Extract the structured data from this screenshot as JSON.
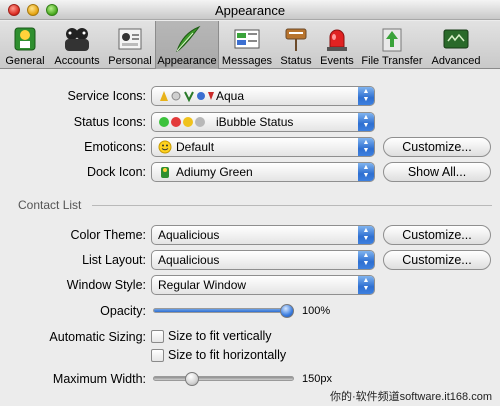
{
  "window": {
    "title": "Appearance"
  },
  "toolbar": {
    "items": [
      {
        "label": "General"
      },
      {
        "label": "Accounts"
      },
      {
        "label": "Personal"
      },
      {
        "label": "Appearance"
      },
      {
        "label": "Messages"
      },
      {
        "label": "Status"
      },
      {
        "label": "Events"
      },
      {
        "label": "File Transfer"
      },
      {
        "label": "Advanced"
      }
    ],
    "selected": "Appearance"
  },
  "appearance": {
    "service_icons": {
      "label": "Service Icons:",
      "value": "Aqua"
    },
    "status_icons": {
      "label": "Status Icons:",
      "value": "iBubble Status"
    },
    "emoticons": {
      "label": "Emoticons:",
      "value": "Default",
      "button": "Customize..."
    },
    "dock_icon": {
      "label": "Dock Icon:",
      "value": "Adiumy Green",
      "button": "Show All..."
    }
  },
  "contact_list": {
    "section_title": "Contact List",
    "color_theme": {
      "label": "Color Theme:",
      "value": "Aqualicious",
      "button": "Customize..."
    },
    "list_layout": {
      "label": "List Layout:",
      "value": "Aqualicious",
      "button": "Customize..."
    },
    "window_style": {
      "label": "Window Style:",
      "value": "Regular Window"
    },
    "opacity": {
      "label": "Opacity:",
      "value": 1.0,
      "value_text": "100%"
    },
    "automatic_sizing": {
      "label": "Automatic Sizing:",
      "vertical": {
        "label": "Size to fit vertically",
        "checked": false
      },
      "horizontal": {
        "label": "Size to fit horizontally",
        "checked": false
      }
    },
    "maximum_width": {
      "label": "Maximum Width:",
      "value": 0.25,
      "value_text": "150px"
    }
  },
  "watermark": "你的·软件频道software.it168.com",
  "colors": {
    "accent": "#3b7de0",
    "selected_tab": "#ababab"
  }
}
